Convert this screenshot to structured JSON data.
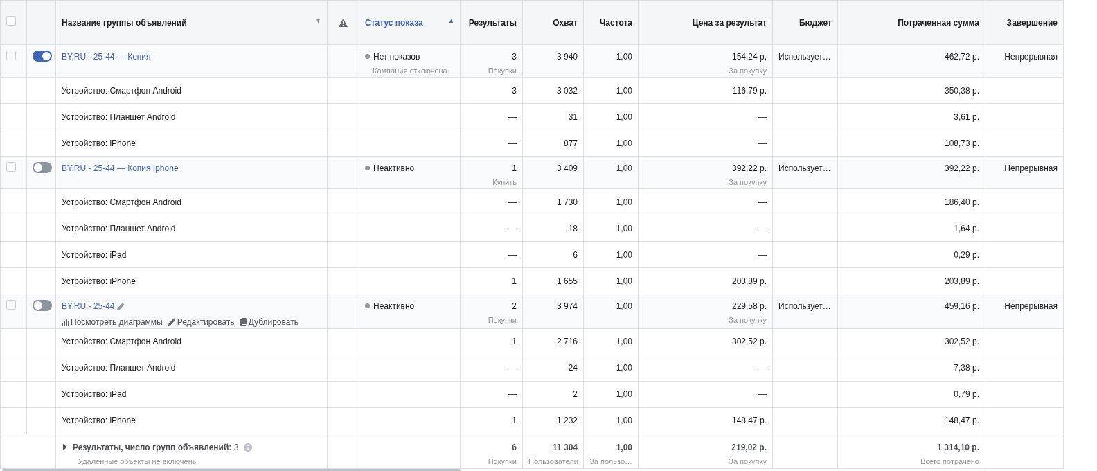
{
  "header": {
    "select_all": {
      "checked": false
    },
    "columns": [
      {
        "label": "Название группы объявлений",
        "selected": false,
        "arrow": "▼"
      },
      {
        "label": "Статус показа",
        "selected": true,
        "arrow": "▲"
      },
      {
        "label": "Результаты",
        "selected": false
      },
      {
        "label": "Охват",
        "selected": false
      },
      {
        "label": "Частота",
        "selected": false
      },
      {
        "label": "Цена за результат",
        "selected": false
      },
      {
        "label": "Бюджет",
        "selected": false
      },
      {
        "label": "Потраченная сумма",
        "selected": false
      },
      {
        "label": "Завершение",
        "selected": false
      }
    ]
  },
  "ad_sets": [
    {
      "checked": false,
      "on": true,
      "name": "BY,RU - 25-44 — Копия",
      "hovered": false,
      "status": "Нет показов",
      "status_note": "Кампания отключена",
      "results": "3",
      "results_unit": "Покупки",
      "reach": "3 940",
      "frequency": "1,00",
      "cost": "154,24 р.",
      "cost_unit": "За покупку",
      "budget": "Использует…",
      "spent": "462,72 р.",
      "ending": "Непрерывная",
      "breakdown": [
        {
          "device": "Устройство: Смартфон Android",
          "results": "3",
          "reach": "3 032",
          "frequency": "1,00",
          "cost": "116,79 р.",
          "spent": "350,38 р."
        },
        {
          "device": "Устройство: Планшет Android",
          "results": "—",
          "reach": "31",
          "frequency": "1,00",
          "cost": "—",
          "spent": "3,61 р."
        },
        {
          "device": "Устройство: iPhone",
          "results": "—",
          "reach": "877",
          "frequency": "1,00",
          "cost": "—",
          "spent": "108,73 р."
        }
      ]
    },
    {
      "checked": false,
      "on": false,
      "name": "BY,RU - 25-44 — Копия Iphone",
      "hovered": false,
      "status": "Неактивно",
      "results": "1",
      "results_unit": "Купить",
      "reach": "3 409",
      "frequency": "1,00",
      "cost": "392,22 р.",
      "cost_unit": "За покупку",
      "budget": "Использует…",
      "spent": "392,22 р.",
      "ending": "Непрерывная",
      "breakdown": [
        {
          "device": "Устройство: Смартфон Android",
          "results": "—",
          "reach": "1 730",
          "frequency": "1,00",
          "cost": "—",
          "spent": "186,40 р."
        },
        {
          "device": "Устройство: Планшет Android",
          "results": "—",
          "reach": "18",
          "frequency": "1,00",
          "cost": "—",
          "spent": "1,64 р."
        },
        {
          "device": "Устройство: iPad",
          "results": "—",
          "reach": "6",
          "frequency": "1,00",
          "cost": "—",
          "spent": "0,29 р."
        },
        {
          "device": "Устройство: iPhone",
          "results": "1",
          "reach": "1 655",
          "frequency": "1,00",
          "cost": "203,89 р.",
          "spent": "203,89 р."
        }
      ]
    },
    {
      "checked": false,
      "on": false,
      "name": "BY,RU - 25-44",
      "hovered": true,
      "status": "Неактивно",
      "results": "2",
      "results_unit": "Покупки",
      "reach": "3 974",
      "frequency": "1,00",
      "cost": "229,58 р.",
      "cost_unit": "За покупку",
      "budget": "Использует…",
      "spent": "459,16 р.",
      "ending": "Непрерывная",
      "actions": [
        {
          "kind": "charts",
          "label": "Посмотреть диаграммы"
        },
        {
          "kind": "edit",
          "label": "Редактировать"
        },
        {
          "kind": "duplicate",
          "label": "Дублировать"
        }
      ],
      "breakdown": [
        {
          "device": "Устройство: Смартфон Android",
          "results": "1",
          "reach": "2 716",
          "frequency": "1,00",
          "cost": "302,52 р.",
          "spent": "302,52 р."
        },
        {
          "device": "Устройство: Планшет Android",
          "results": "—",
          "reach": "24",
          "frequency": "1,00",
          "cost": "—",
          "spent": "7,38 р."
        },
        {
          "device": "Устройство: iPad",
          "results": "—",
          "reach": "2",
          "frequency": "1,00",
          "cost": "—",
          "spent": "0,79 р."
        },
        {
          "device": "Устройство: iPhone",
          "results": "1",
          "reach": "1 232",
          "frequency": "1,00",
          "cost": "148,47 р.",
          "spent": "148,47 р."
        }
      ]
    }
  ],
  "totals": {
    "label": "**Результаты, число групп объявлений:** 3",
    "note": "Удаленные объекты не включены",
    "results": "6",
    "results_unit": "Покупки",
    "reach": "11 304",
    "reach_unit": "Пользователи",
    "frequency": "1,00",
    "frequency_unit": "За пользо…",
    "cost": "219,02 р.",
    "cost_unit": "За покупку",
    "spent": "1 314,10 р.",
    "spent_unit": "Всего потрачено"
  }
}
